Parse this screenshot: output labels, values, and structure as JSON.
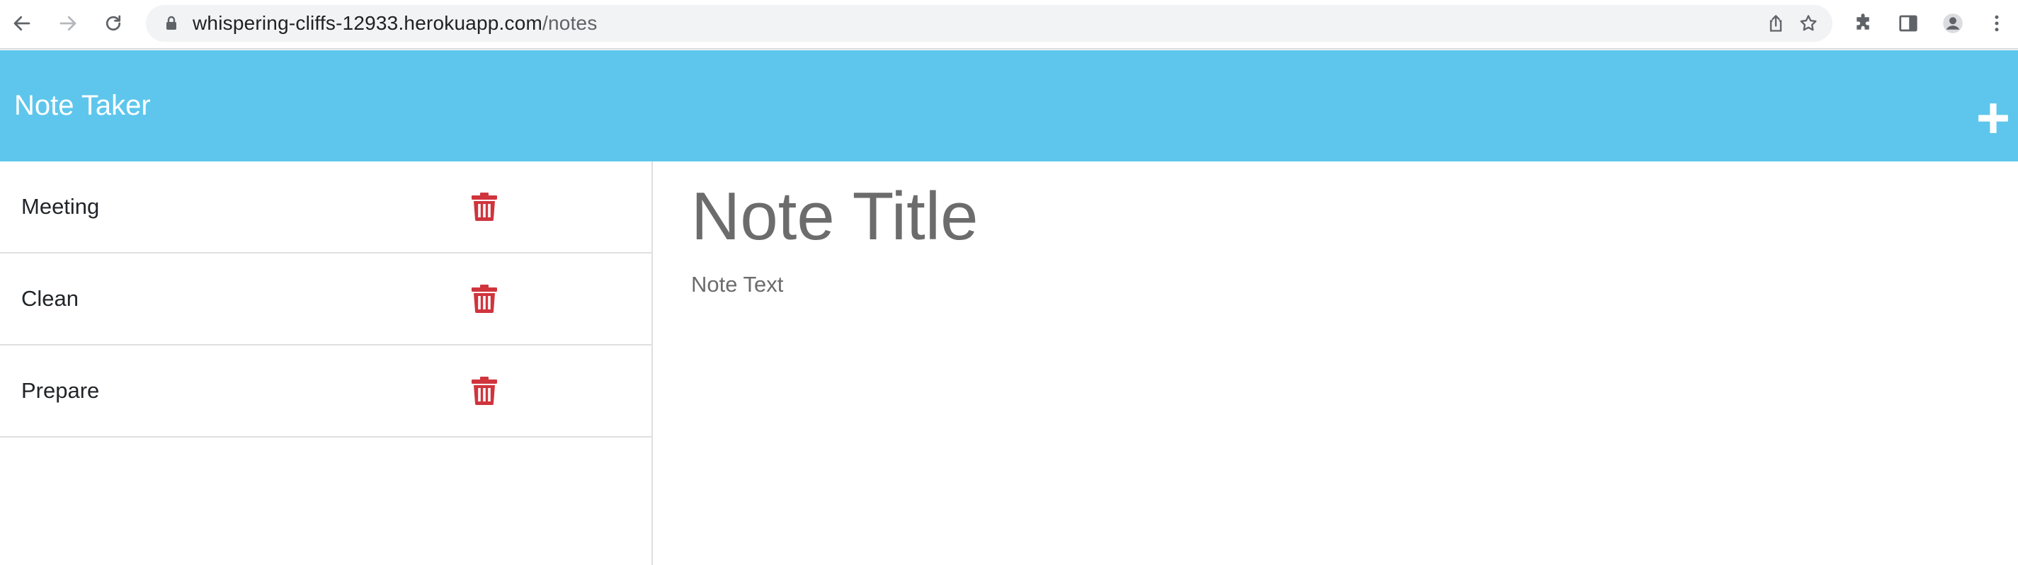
{
  "browser": {
    "url_host": "whispering-cliffs-12933.herokuapp.com",
    "url_path": "/notes",
    "icons": {
      "back": "arrow-left-icon",
      "forward": "arrow-right-icon",
      "reload": "reload-icon",
      "lock": "lock-icon",
      "share": "share-icon",
      "bookmark": "star-icon",
      "extensions": "puzzle-icon",
      "side_panel": "side-panel-icon",
      "profile": "avatar-icon",
      "menu": "kebab-menu-icon"
    }
  },
  "header": {
    "title": "Note Taker",
    "new_note_icon": "plus-icon",
    "background": "#5ec6ec"
  },
  "notes": [
    {
      "title": "Meeting"
    },
    {
      "title": "Clean"
    },
    {
      "title": "Prepare"
    }
  ],
  "delete_icon": {
    "name": "trash-icon",
    "color": "#d0343d"
  },
  "editor": {
    "title_placeholder": "Note Title",
    "text_placeholder": "Note Text"
  }
}
